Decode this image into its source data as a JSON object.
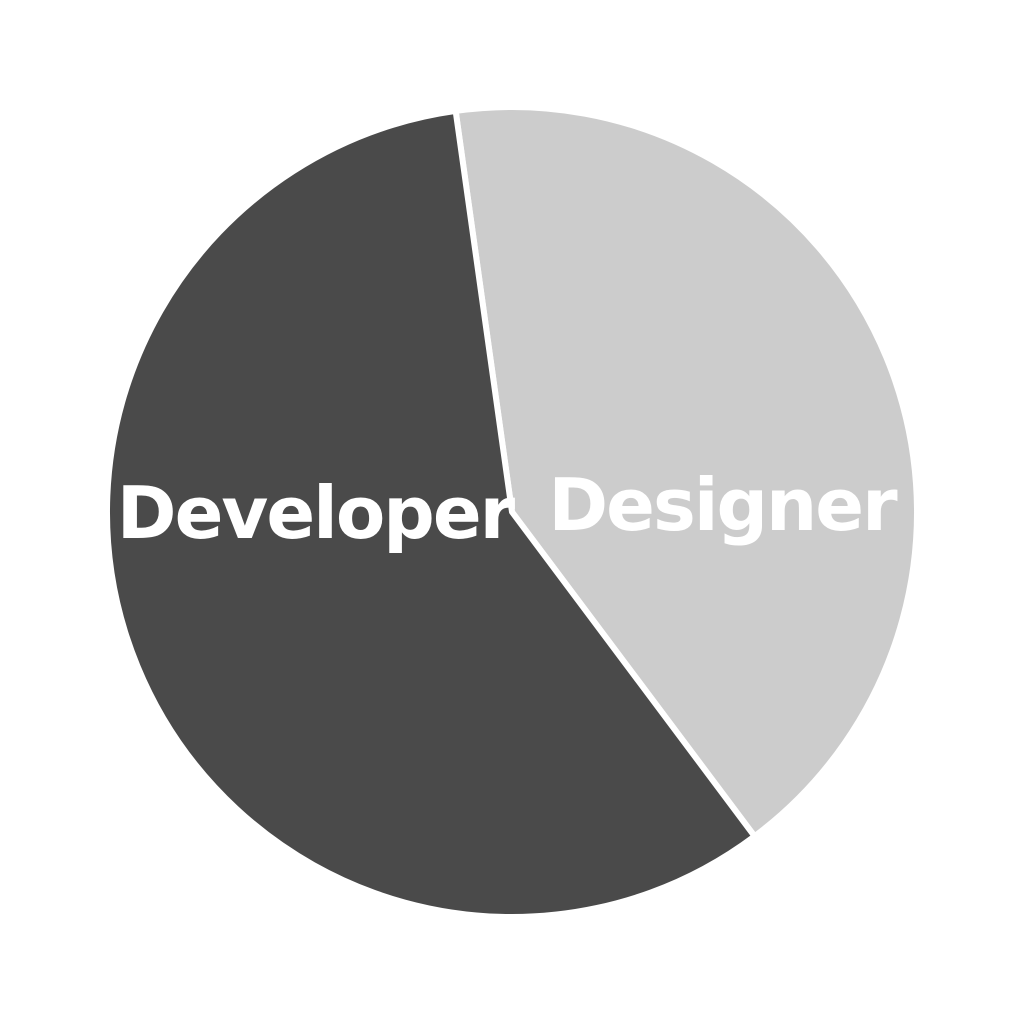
{
  "chart_data": {
    "type": "pie",
    "categories": [
      "Developer",
      "Designer"
    ],
    "values": [
      58,
      42
    ],
    "colors": [
      "#4a4a4a",
      "#cccccc"
    ],
    "label_colors": [
      "#ffffff",
      "#ffffff"
    ],
    "legend": "none",
    "title": ""
  }
}
